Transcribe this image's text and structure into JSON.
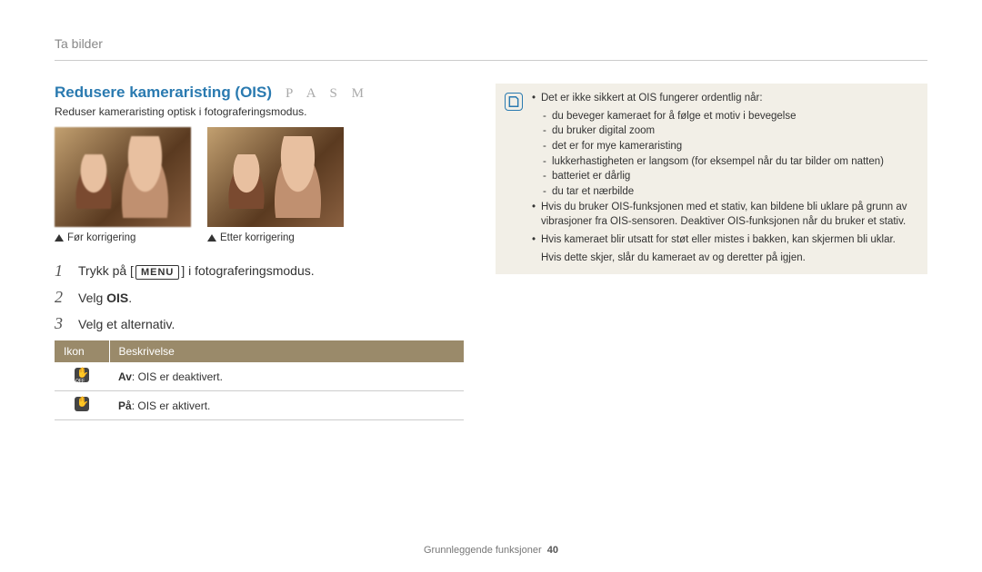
{
  "breadcrumb": "Ta bilder",
  "heading": "Redusere kameraristing (OIS)",
  "modes": "P A S M",
  "subheading": "Reduser kameraristing optisk i fotograferingsmodus.",
  "captions": {
    "before": "Før korrigering",
    "after": "Etter korrigering"
  },
  "steps": {
    "s1_pre": "Trykk på [",
    "s1_menu": "MENU",
    "s1_post": "] i fotograferingsmodus.",
    "s2_pre": "Velg ",
    "s2_bold": "OIS",
    "s2_post": ".",
    "s3": "Velg et alternativ."
  },
  "table": {
    "head_icon": "Ikon",
    "head_desc": "Beskrivelse",
    "row1_label": "Av",
    "row1_text": ": OIS er deaktivert.",
    "row2_label": "På",
    "row2_text": ": OIS er aktivert."
  },
  "note": {
    "l1": "Det er ikke sikkert at OIS fungerer ordentlig når:",
    "s1": "du beveger kameraet for å følge et motiv i bevegelse",
    "s2": "du bruker digital zoom",
    "s3": "det er for mye kameraristing",
    "s4": "lukkerhastigheten er langsom (for eksempel når du tar bilder om natten)",
    "s5": "batteriet er dårlig",
    "s6": "du tar et nærbilde",
    "l2": "Hvis du bruker OIS-funksjonen med et stativ, kan bildene bli uklare på grunn av vibrasjoner fra OIS-sensoren. Deaktiver OIS-funksjonen når du bruker et stativ.",
    "l3a": "Hvis kameraet blir utsatt for støt eller mistes i bakken, kan skjermen bli uklar.",
    "l3b": "Hvis dette skjer, slår du kameraet av og deretter på igjen."
  },
  "footer": {
    "section": "Grunnleggende funksjoner",
    "page": "40"
  }
}
